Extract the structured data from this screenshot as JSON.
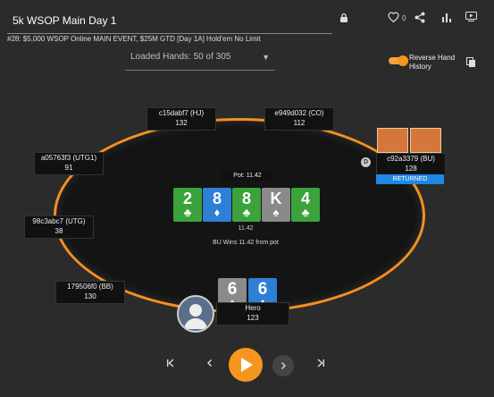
{
  "header": {
    "title": "5k WSOP Main Day 1",
    "subtitle": "#28: $5,000 WSOP Online MAIN EVENT, $25M GTD [Day 1A] Hold'em No Limit",
    "like_count": "0"
  },
  "loaded_hands": {
    "label": "Loaded Hands: 50 of 305"
  },
  "reverse_history": {
    "line1": "Reverse Hand",
    "line2": "History",
    "enabled": true
  },
  "seats": [
    {
      "name": "c15dabf7 (HJ)",
      "stack": "132"
    },
    {
      "name": "e949d032 (CO)",
      "stack": "112"
    },
    {
      "name": "a05763f3 (UTG1)",
      "stack": "91"
    },
    {
      "name": "c92a3379 (BU)",
      "stack": "128"
    },
    {
      "name": "98c3abc7 (UTG)",
      "stack": "38"
    },
    {
      "name": "179506f0 (BB)",
      "stack": "130"
    },
    {
      "name": "Hero",
      "stack": "123"
    }
  ],
  "pot": {
    "label": "Pot: 11.42",
    "amount": "11.42",
    "result": "BU Wins 11.42 from pot"
  },
  "board": [
    {
      "rank": "2",
      "suit": "♣",
      "color": "green"
    },
    {
      "rank": "8",
      "suit": "♦",
      "color": "blue"
    },
    {
      "rank": "8",
      "suit": "♣",
      "color": "green"
    },
    {
      "rank": "K",
      "suit": "♠",
      "color": "grey"
    },
    {
      "rank": "4",
      "suit": "♣",
      "color": "green"
    }
  ],
  "hero_cards": [
    {
      "rank": "6",
      "suit": "♠",
      "color": "grey"
    },
    {
      "rank": "6",
      "suit": "♦",
      "color": "blue"
    }
  ],
  "bu_status": "RETURNED",
  "dealer_label": "D",
  "colors": {
    "accent": "#f7961e",
    "table_border": "#f5901e",
    "returned": "#1e88e5"
  }
}
